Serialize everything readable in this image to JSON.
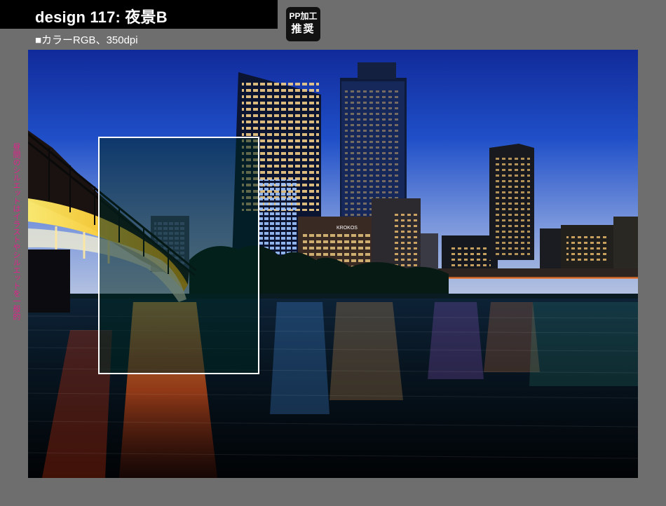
{
  "header": {
    "title": "design 117: 夜景B",
    "subtitle": "■カラーRGB、350dpi"
  },
  "badge": {
    "line1": "PP加工",
    "line2": "推奨"
  },
  "side_note": "昼間のシルエットはイラストやシルエットを一般的",
  "photo": {
    "building_sign": "KROKOS",
    "colors": {
      "sky_top": "#1a3fb8",
      "sky_horizon": "#a8bde0",
      "water": "#05121c",
      "bridge_light": "#ffe14a",
      "reflection_orange": "#ff6a1a"
    }
  },
  "selection_box": {
    "border_color": "#ffffff",
    "tint_color": "#00261f"
  }
}
